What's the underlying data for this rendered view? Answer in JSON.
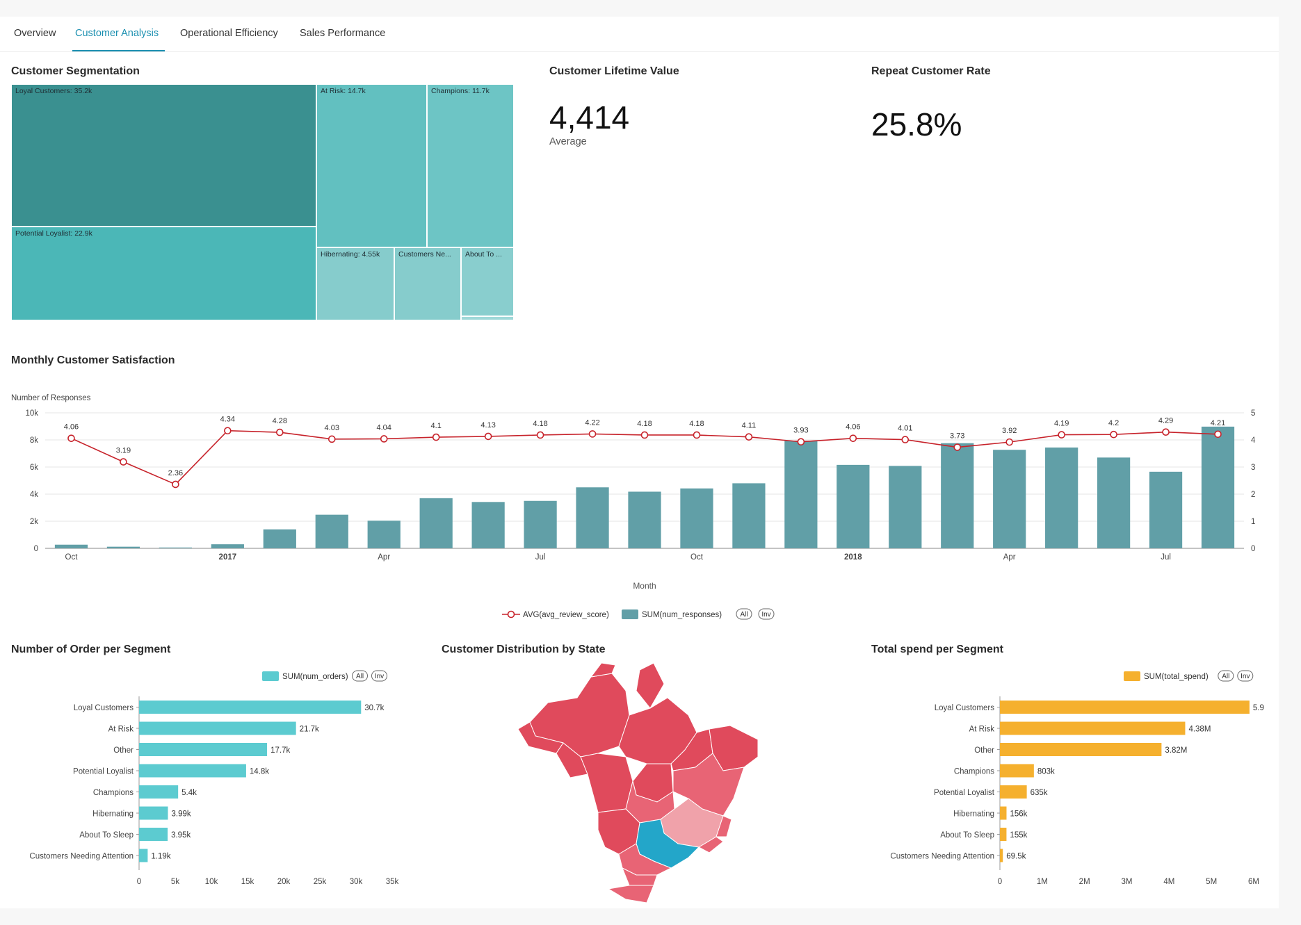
{
  "tabs": [
    {
      "label": "Overview",
      "active": false
    },
    {
      "label": "Customer Analysis",
      "active": true
    },
    {
      "label": "Operational Efficiency",
      "active": false
    },
    {
      "label": "Sales Performance",
      "active": false
    }
  ],
  "segmentation": {
    "title": "Customer Segmentation",
    "cells": [
      {
        "label": "Loyal Customers: 35.2k",
        "color": "#3a9090"
      },
      {
        "label": "Potential Loyalist: 22.9k",
        "color": "#4bb7b7"
      },
      {
        "label": "At Risk: 14.7k",
        "color": "#62c0c0"
      },
      {
        "label": "Champions: 11.7k",
        "color": "#6dc5c5"
      },
      {
        "label": "Hibernating: 4.55k",
        "color": "#86cccc"
      },
      {
        "label": "Customers Ne...",
        "color": "#86cccc"
      },
      {
        "label": "About To ...",
        "color": "#89cece"
      },
      {
        "label": "",
        "color": "#9fd8d8"
      }
    ]
  },
  "clv": {
    "title": "Customer Lifetime Value",
    "value": "4,414",
    "subtitle": "Average"
  },
  "repeat": {
    "title": "Repeat Customer Rate",
    "value": "25.8%"
  },
  "satisfaction": {
    "title": "Monthly Customer Satisfaction",
    "legend": {
      "line": "AVG(avg_review_score)",
      "bar": "SUM(num_responses)",
      "all": "All",
      "inv": "Inv"
    },
    "colors": {
      "bar": "#619fa7",
      "line": "#c7232b"
    }
  },
  "orders_segment": {
    "title": "Number of Order per Segment",
    "legend": {
      "series": "SUM(num_orders)",
      "all": "All",
      "inv": "Inv"
    },
    "color": "#5ccbd0"
  },
  "state_map": {
    "title": "Customer Distribution by State",
    "colors": {
      "high": "#e04a5c",
      "mid": "#e86475",
      "low": "#f0a2aa",
      "top": "#23a6c9"
    }
  },
  "spend_segment": {
    "title": "Total spend per Segment",
    "legend": {
      "series": "SUM(total_spend)",
      "all": "All",
      "inv": "Inv"
    },
    "color": "#f5b02e"
  },
  "chart_data": [
    {
      "type": "bar",
      "title": "Monthly Customer Satisfaction",
      "xlabel": "Month",
      "ylabel": "Number of Responses",
      "categories": [
        "2016-10",
        "2016-11",
        "2016-12",
        "2017-01",
        "2017-02",
        "2017-03",
        "2017-04",
        "2017-05",
        "2017-06",
        "2017-07",
        "2017-08",
        "2017-09",
        "2017-10",
        "2017-11",
        "2017-12",
        "2018-01",
        "2018-02",
        "2018-03",
        "2018-04",
        "2018-05",
        "2018-06",
        "2018-07",
        "2018-08"
      ],
      "x_tick_labels": [
        {
          "category": "2016-10",
          "label": "Oct",
          "bold": false
        },
        {
          "category": "2017-01",
          "label": "2017",
          "bold": true
        },
        {
          "category": "2017-04",
          "label": "Apr",
          "bold": false
        },
        {
          "category": "2017-07",
          "label": "Jul",
          "bold": false
        },
        {
          "category": "2017-10",
          "label": "Oct",
          "bold": false
        },
        {
          "category": "2018-01",
          "label": "2018",
          "bold": true
        },
        {
          "category": "2018-04",
          "label": "Apr",
          "bold": false
        },
        {
          "category": "2018-07",
          "label": "Jul",
          "bold": false
        }
      ],
      "ylim": [
        0,
        10000
      ],
      "yticks": [
        "0",
        "2k",
        "4k",
        "6k",
        "8k",
        "10k"
      ],
      "y2lim": [
        0,
        5
      ],
      "y2ticks": [
        "0",
        "1",
        "2",
        "3",
        "4",
        "5"
      ],
      "series": [
        {
          "name": "SUM(num_responses)",
          "type": "bar",
          "values": [
            270,
            120,
            60,
            300,
            1400,
            2480,
            2040,
            3700,
            3420,
            3500,
            4500,
            4180,
            4420,
            4800,
            7940,
            6160,
            6080,
            7760,
            7270,
            7440,
            6700,
            5650,
            8980
          ]
        },
        {
          "name": "AVG(avg_review_score)",
          "type": "line",
          "axis": "right",
          "values": [
            4.06,
            3.19,
            2.36,
            4.34,
            4.28,
            4.03,
            4.04,
            4.1,
            4.13,
            4.18,
            4.22,
            4.18,
            4.18,
            4.11,
            3.93,
            4.06,
            4.01,
            3.73,
            3.92,
            4.19,
            4.2,
            4.29,
            4.21
          ]
        }
      ],
      "grid": true,
      "legend_position": "bottom"
    },
    {
      "type": "bar",
      "orientation": "horizontal",
      "title": "Number of Order per Segment",
      "categories": [
        "Loyal Customers",
        "At Risk",
        "Other",
        "Potential Loyalist",
        "Champions",
        "Hibernating",
        "About To Sleep",
        "Customers Needing Attention"
      ],
      "series": [
        {
          "name": "SUM(num_orders)",
          "values": [
            30700,
            21700,
            17700,
            14800,
            5400,
            3990,
            3950,
            1190
          ]
        }
      ],
      "data_labels": [
        "30.7k",
        "21.7k",
        "17.7k",
        "14.8k",
        "5.4k",
        "3.99k",
        "3.95k",
        "1.19k"
      ],
      "xlim": [
        0,
        35000
      ],
      "xticks": [
        "0",
        "5k",
        "10k",
        "15k",
        "20k",
        "25k",
        "30k",
        "35k"
      ],
      "legend_position": "top-right"
    },
    {
      "type": "bar",
      "orientation": "horizontal",
      "title": "Total spend per Segment",
      "categories": [
        "Loyal Customers",
        "At Risk",
        "Other",
        "Champions",
        "Potential Loyalist",
        "Hibernating",
        "About To Sleep",
        "Customers Needing Attention"
      ],
      "series": [
        {
          "name": "SUM(total_spend)",
          "values": [
            5900000,
            4380000,
            3820000,
            803000,
            635000,
            156000,
            155000,
            69500
          ]
        }
      ],
      "data_labels": [
        "5.9",
        "4.38M",
        "3.82M",
        "803k",
        "635k",
        "156k",
        "155k",
        "69.5k"
      ],
      "xlim": [
        0,
        6000000
      ],
      "xticks": [
        "0",
        "1M",
        "2M",
        "3M",
        "4M",
        "5M",
        "6M"
      ],
      "legend_position": "top-right"
    }
  ]
}
